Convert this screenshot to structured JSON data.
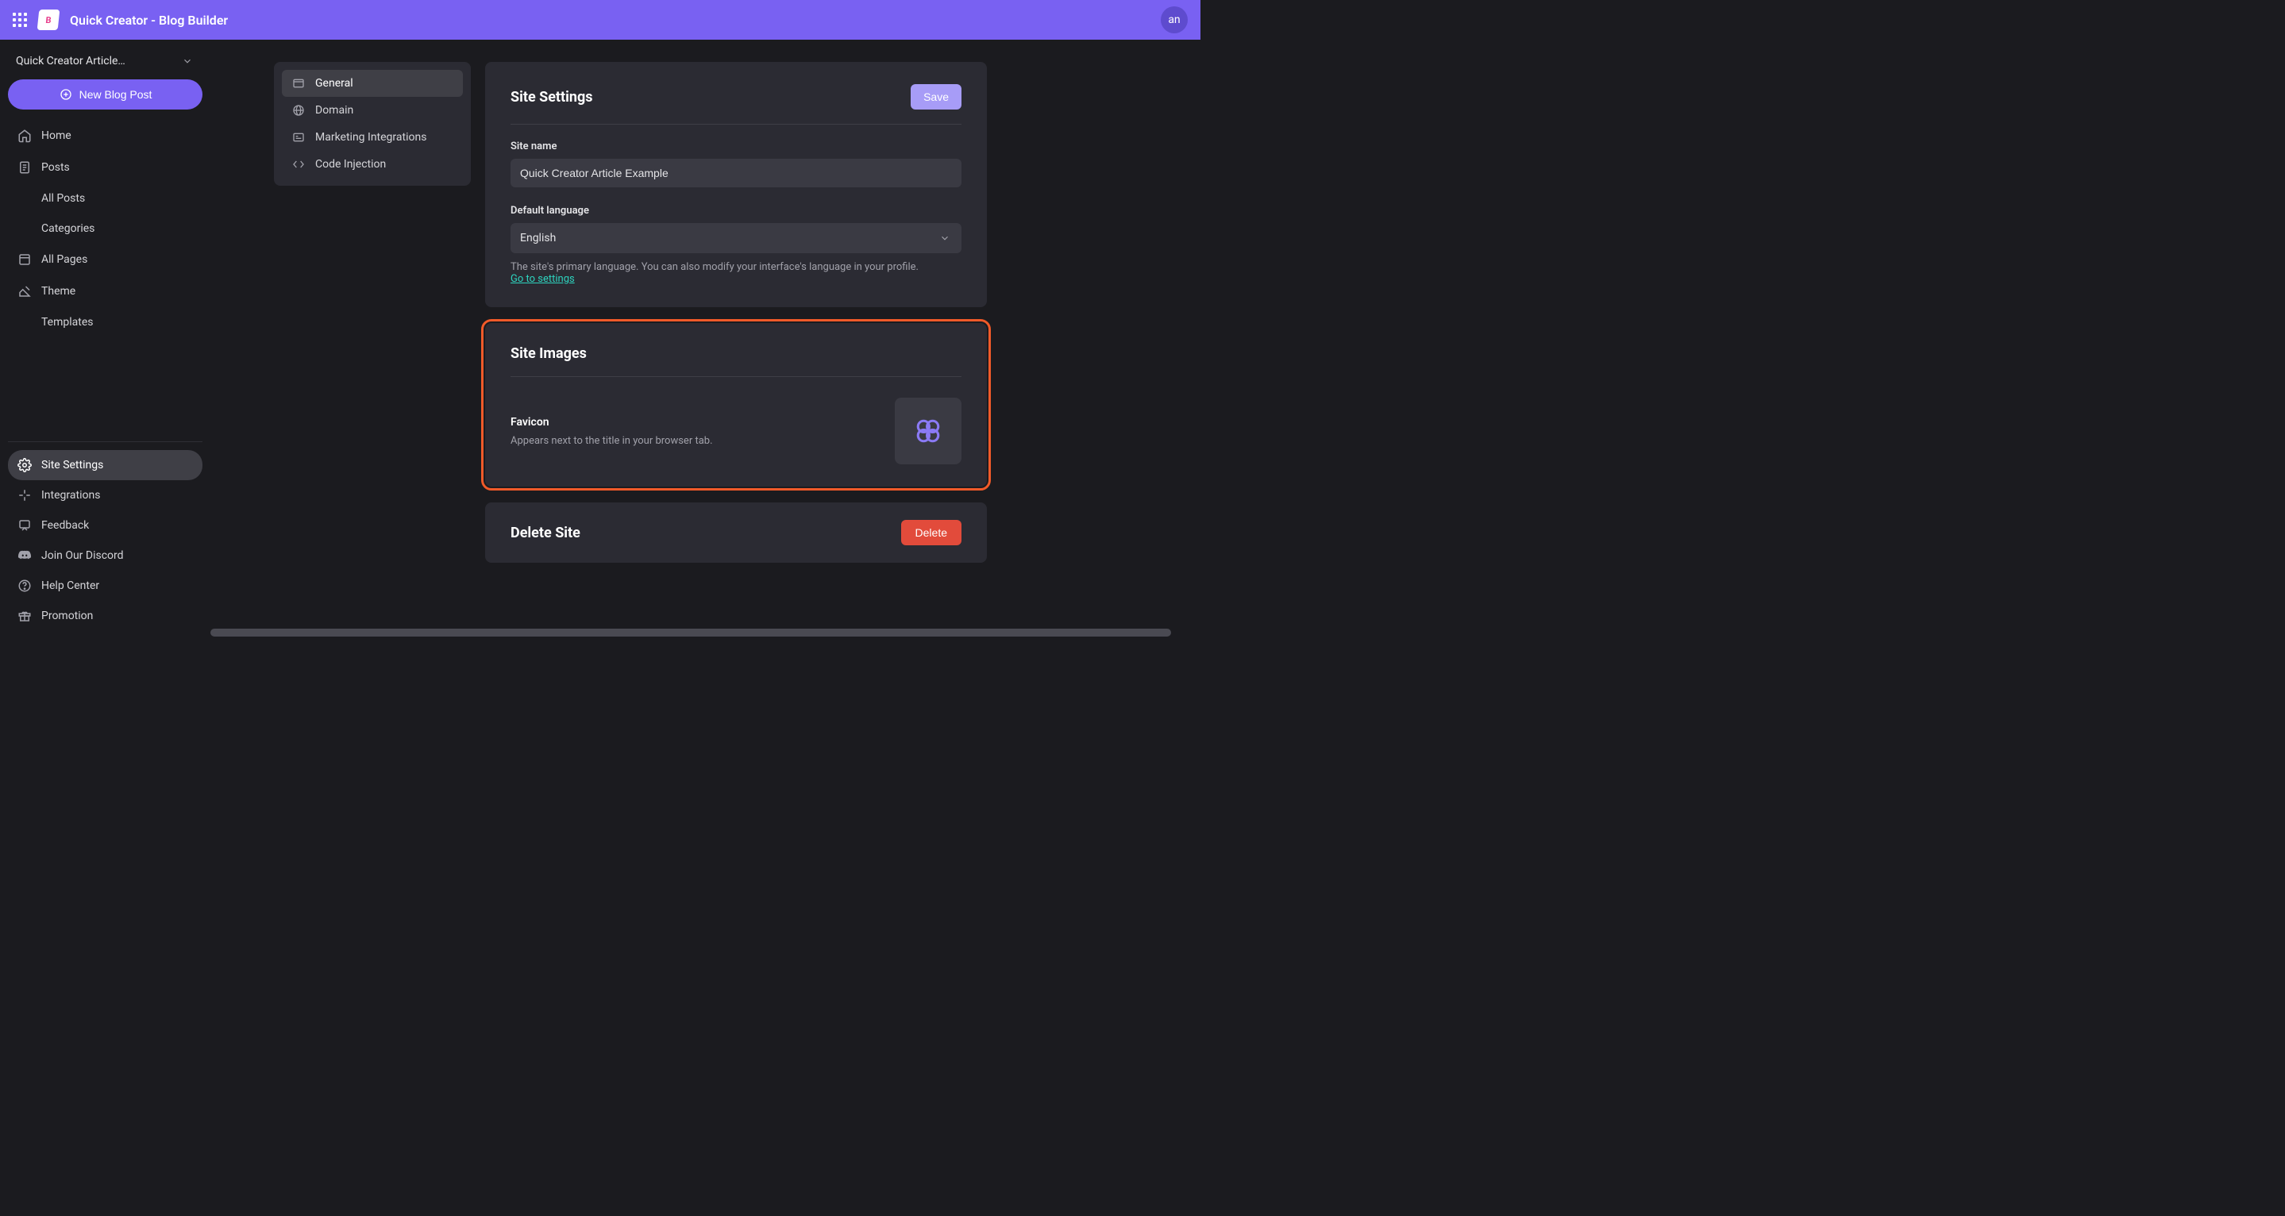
{
  "header": {
    "title": "Quick Creator - Blog Builder",
    "avatar_initials": "an"
  },
  "sidebar": {
    "site_name": "Quick Creator Article…",
    "new_post": "New Blog Post",
    "items": [
      {
        "label": "Home"
      },
      {
        "label": "Posts"
      },
      {
        "label": "All Posts"
      },
      {
        "label": "Categories"
      },
      {
        "label": "All Pages"
      },
      {
        "label": "Theme"
      },
      {
        "label": "Templates"
      }
    ],
    "bottom": [
      {
        "label": "Site Settings"
      },
      {
        "label": "Integrations"
      },
      {
        "label": "Feedback"
      },
      {
        "label": "Join Our Discord"
      },
      {
        "label": "Help Center"
      },
      {
        "label": "Promotion"
      }
    ]
  },
  "settings_nav": [
    {
      "label": "General"
    },
    {
      "label": "Domain"
    },
    {
      "label": "Marketing Integrations"
    },
    {
      "label": "Code Injection"
    }
  ],
  "site_settings": {
    "title": "Site Settings",
    "save_label": "Save",
    "site_name_label": "Site name",
    "site_name_value": "Quick Creator Article Example",
    "language_label": "Default language",
    "language_value": "English",
    "language_helper": "The site's primary language. You can also modify your interface's language in your profile.",
    "language_link": "Go to settings"
  },
  "site_images": {
    "title": "Site Images",
    "favicon_label": "Favicon",
    "favicon_desc": "Appears next to the title in your browser tab."
  },
  "delete_site": {
    "title": "Delete Site",
    "button": "Delete"
  }
}
